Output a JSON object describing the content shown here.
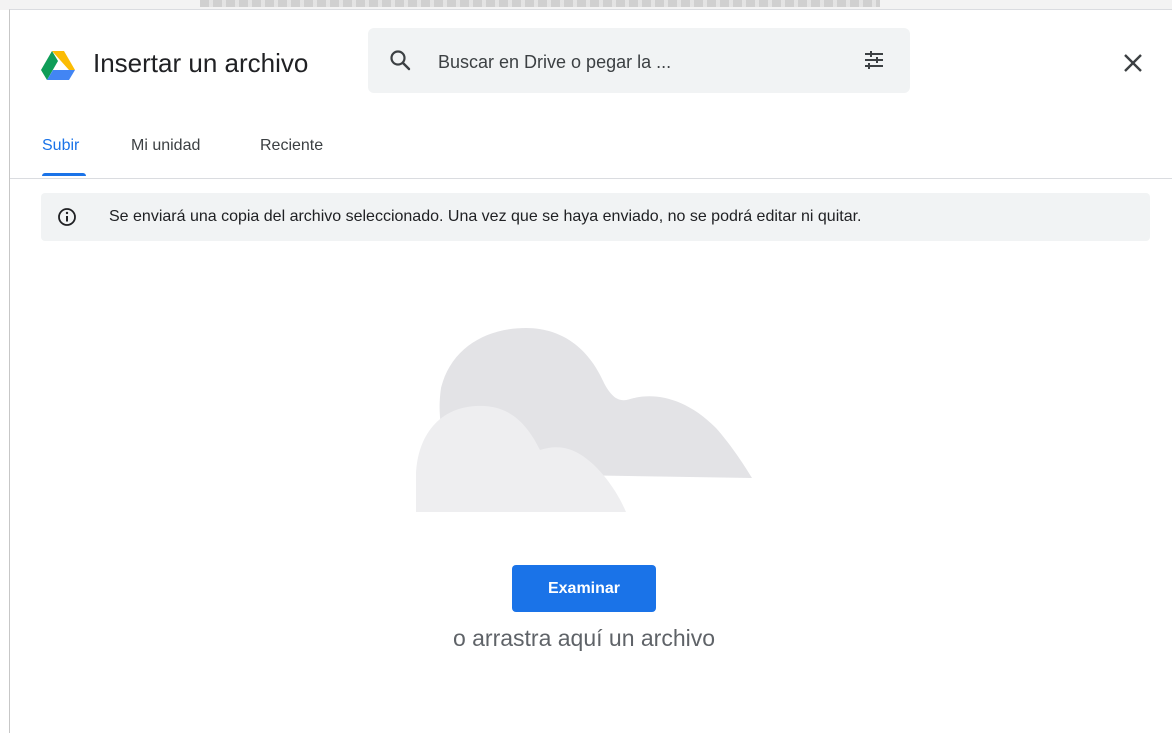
{
  "header": {
    "title": "Insertar un archivo",
    "logo_icon": "google-drive-logo",
    "close_icon": "close-icon"
  },
  "search": {
    "placeholder": "Buscar en Drive o pegar la ...",
    "search_icon": "search-icon",
    "options_icon": "tune-icon"
  },
  "tabs": [
    {
      "label": "Subir",
      "active": true
    },
    {
      "label": "Mi unidad",
      "active": false
    },
    {
      "label": "Reciente",
      "active": false
    }
  ],
  "notice": {
    "icon": "info-icon",
    "text": "Se enviará una copia del archivo seleccionado. Una vez que se haya enviado, no se podrá editar ni quitar."
  },
  "upload": {
    "illustration": "cloud-illustration",
    "button_label": "Examinar",
    "drop_text": "o arrastra aquí un archivo"
  },
  "colors": {
    "accent": "#1a73e8",
    "surface": "#f1f3f4",
    "text_primary": "#202124",
    "text_secondary": "#5f6368",
    "cloud_back": "#e3e3e6",
    "cloud_front": "#eeeef0"
  }
}
